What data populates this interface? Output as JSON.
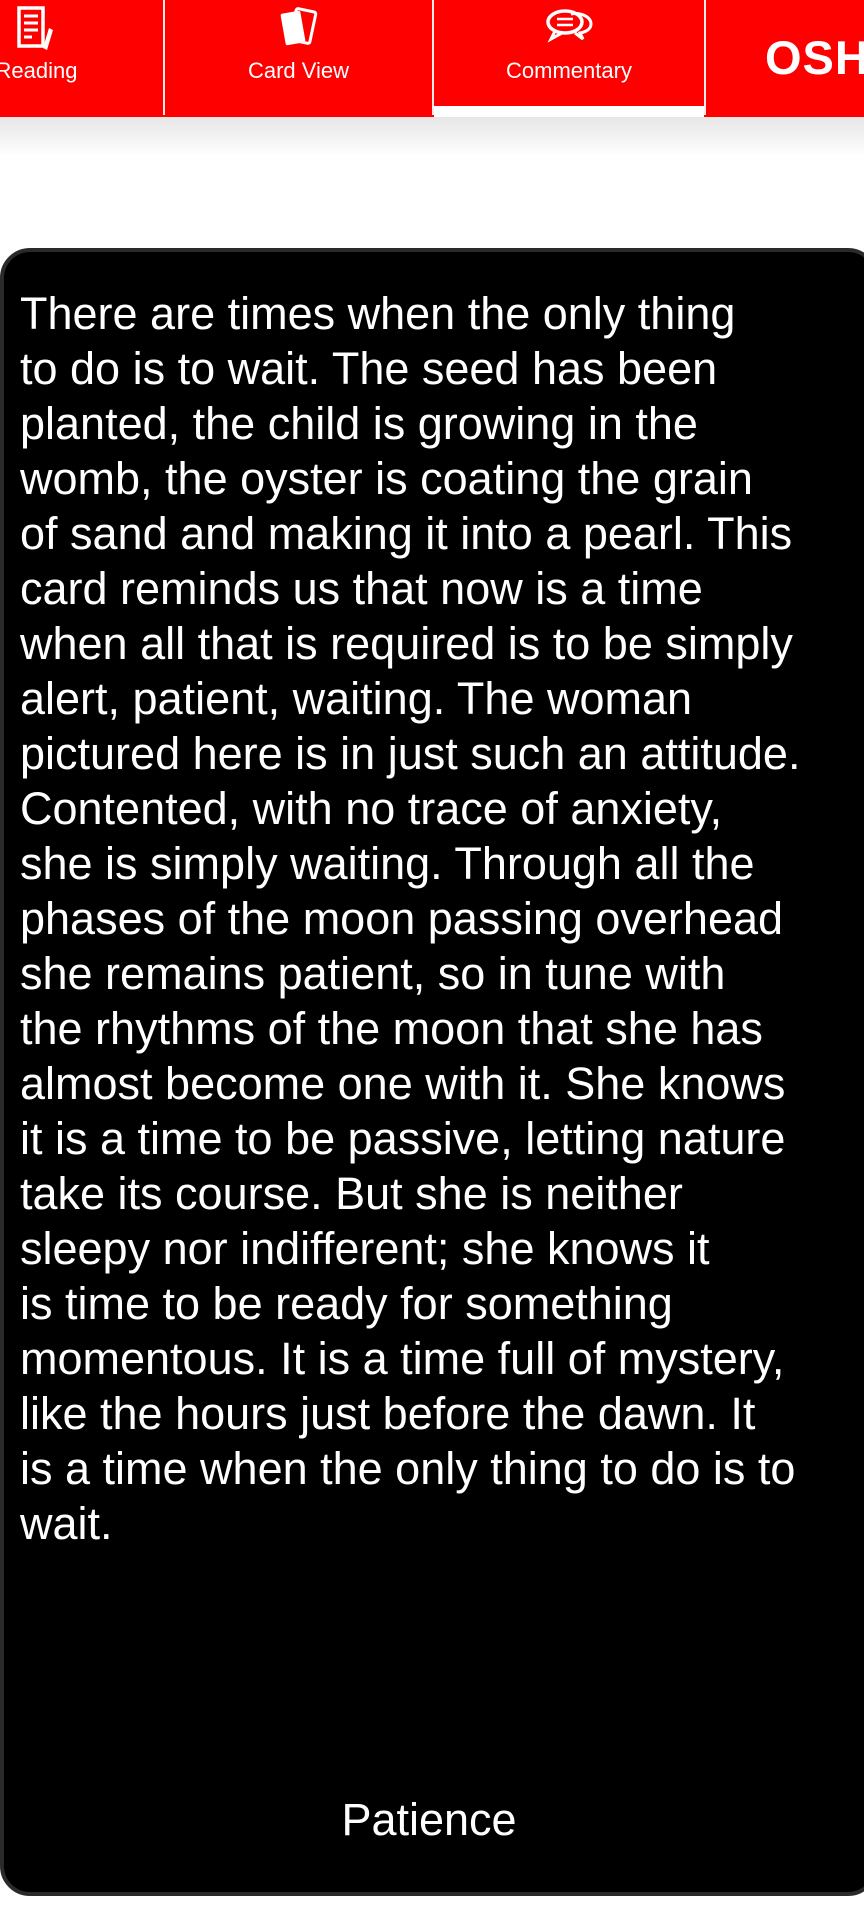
{
  "tabs": [
    {
      "id": "reading",
      "label": "Reading",
      "icon": "document-pen-icon",
      "active": false
    },
    {
      "id": "card_view",
      "label": "Card View",
      "icon": "cards-icon",
      "active": false
    },
    {
      "id": "commentary",
      "label": "Commentary",
      "icon": "speech-bubbles-icon",
      "active": true
    }
  ],
  "brand": {
    "text": "OSHO"
  },
  "colors": {
    "accent": "#ff0000",
    "card_background": "#000000",
    "text": "#ffffff"
  },
  "card": {
    "commentary": "There are times when the only thing\nto do is to wait. The seed has been\nplanted, the child is growing in the\nwomb, the oyster is coating the grain\nof sand and making it into a pearl. This\ncard reminds us that now is a time\nwhen all that is required is to be simply\nalert, patient, waiting. The woman\npictured here is in just such an attitude.\nContented, with no trace of anxiety,\nshe is simply waiting. Through all the\nphases of the moon passing overhead\nshe remains patient, so in tune with\nthe rhythms of the moon that she has\nalmost become one with it. She knows\nit is a time to be passive, letting nature\ntake its course. But she is neither\nsleepy nor indifferent; she knows it\nis time to be ready for something\nmomentous. It is a time full of mystery,\nlike the hours just before the dawn. It\nis a time when the only thing to do is to\nwait.",
    "title": "Patience"
  }
}
